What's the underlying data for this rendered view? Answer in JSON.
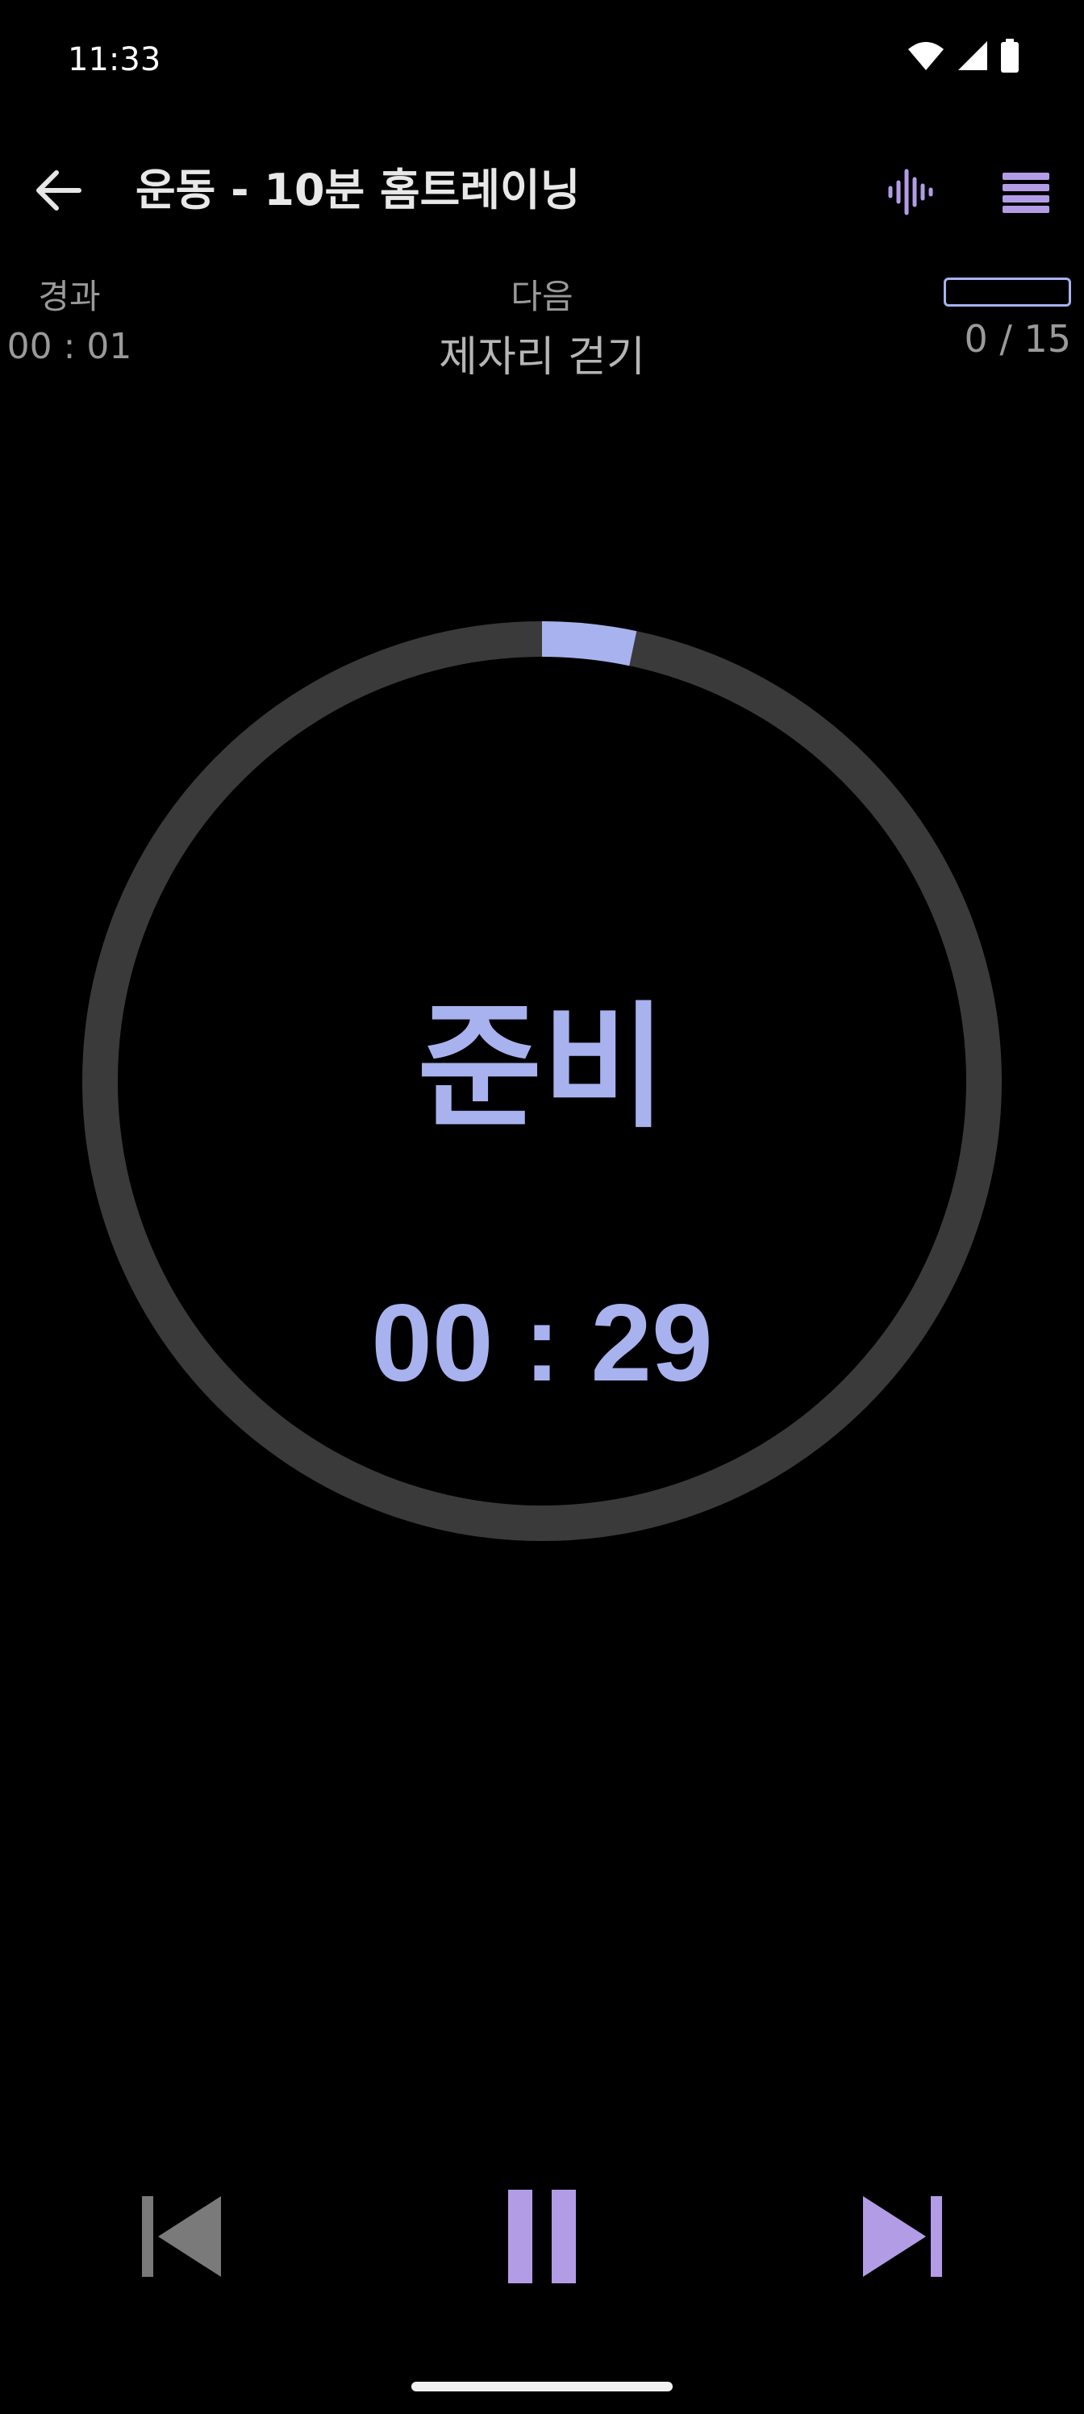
{
  "status_bar": {
    "time": "11:33",
    "icons": [
      "wifi-icon",
      "signal-icon",
      "battery-icon"
    ]
  },
  "app_bar": {
    "back_icon": "arrow-left-icon",
    "title": "운동 - 10분 홈트레이닝",
    "voice_icon": "voice-waveform-icon",
    "menu_icon": "list-menu-icon"
  },
  "info": {
    "elapsed_label": "경과",
    "elapsed_value": "00 : 01",
    "next_label": "다음",
    "next_value": "제자리 걷기",
    "progress_count": "0 / 15",
    "progress_fraction": 0
  },
  "timer": {
    "phase": "준비",
    "remaining": "00 : 29",
    "ring_progress": 0.033,
    "ring_color": "#a8b2ee",
    "track_color": "#3a3a3a"
  },
  "controls": {
    "prev_icon": "skip-previous-icon",
    "pause_icon": "pause-icon",
    "next_icon": "skip-next-icon"
  },
  "colors": {
    "accent": "#a8b2ee",
    "accent_purple": "#b39ce6",
    "background": "#000000"
  }
}
